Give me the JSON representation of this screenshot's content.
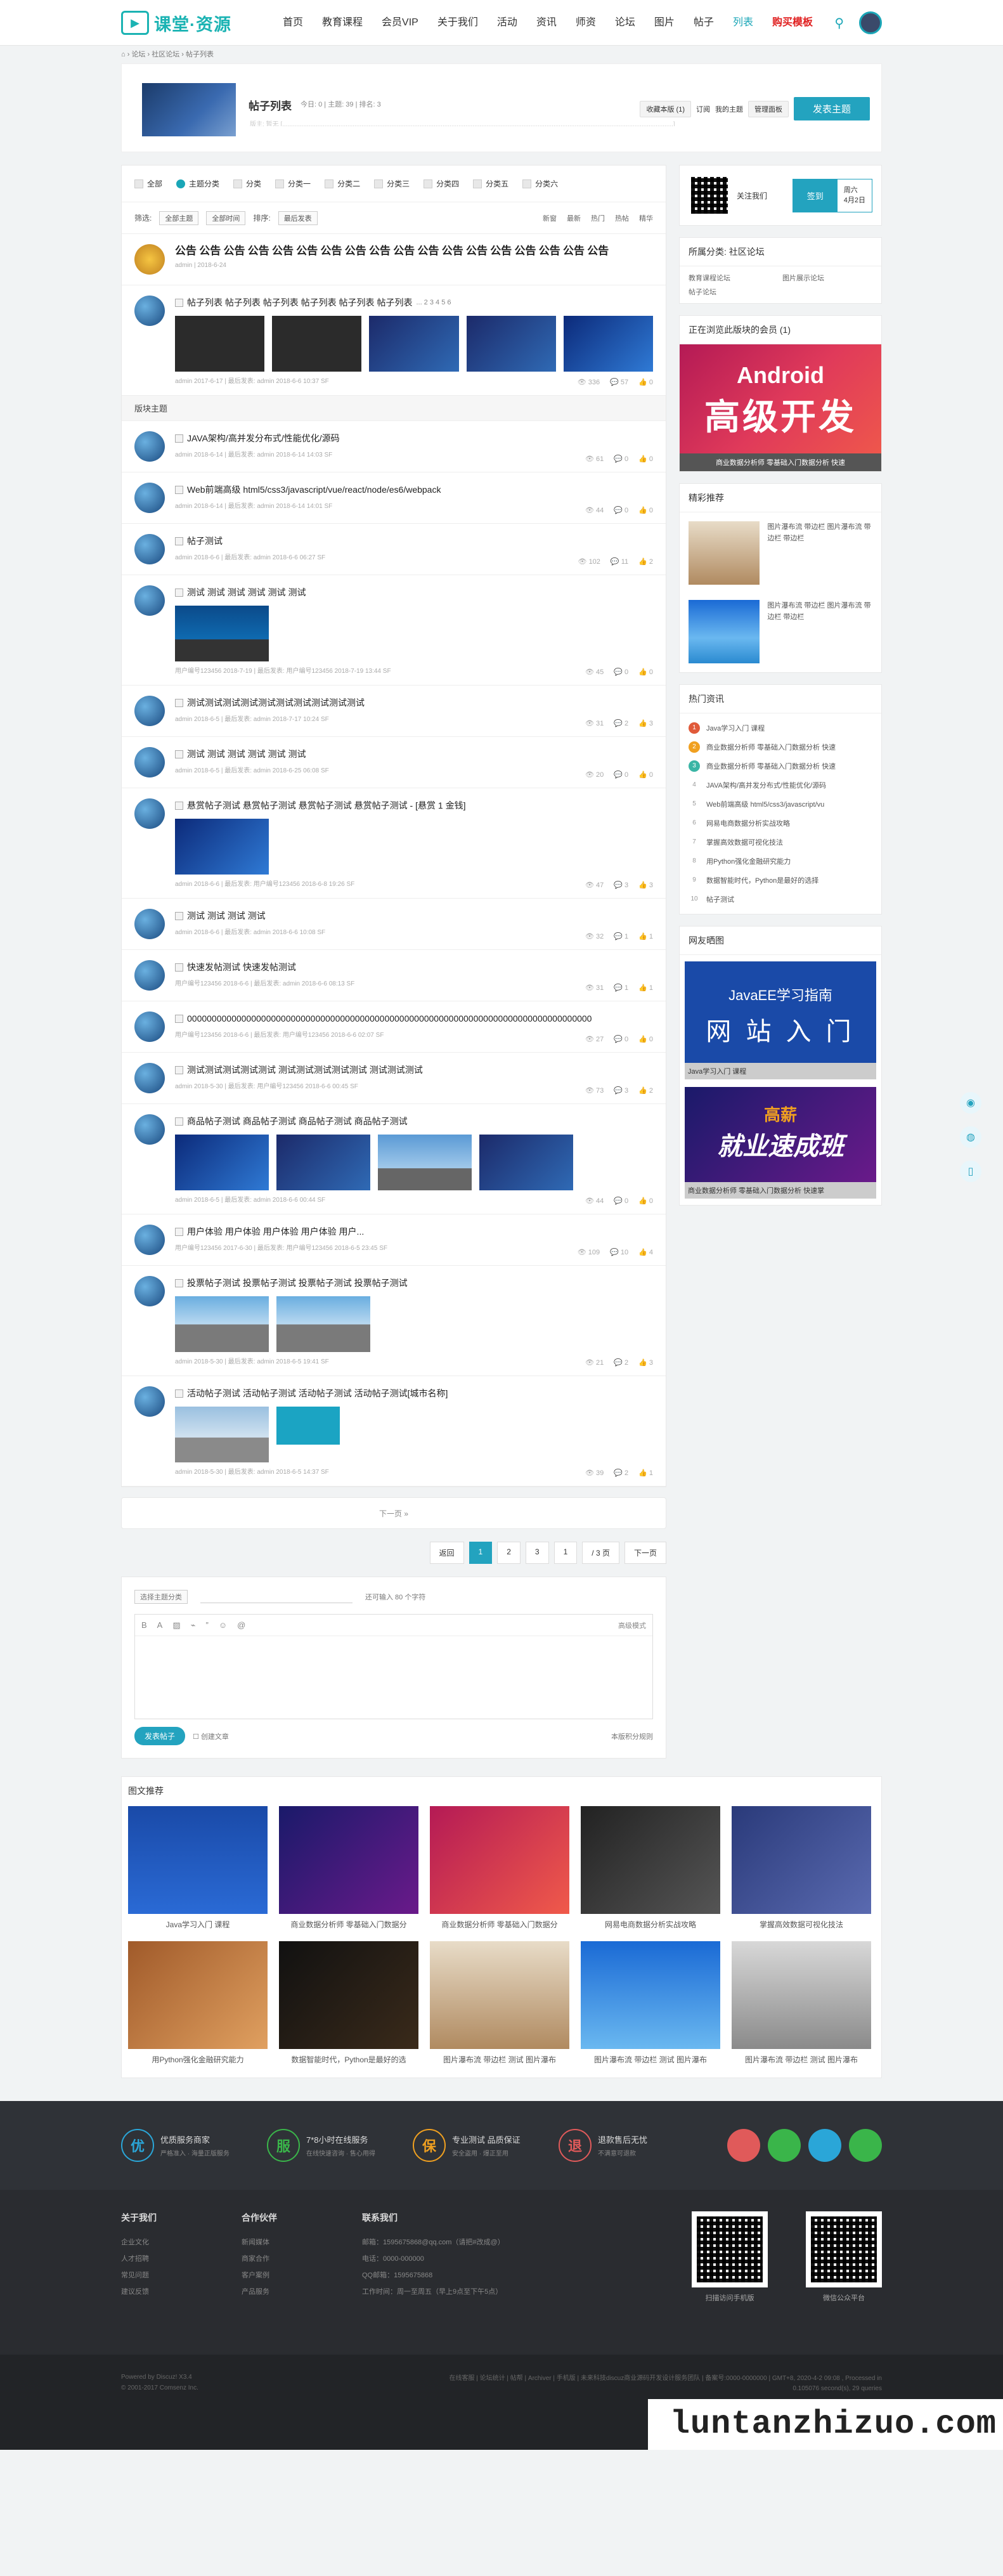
{
  "header": {
    "logo_text": "课堂·资源",
    "nav": [
      "首页",
      "教育课程",
      "会员VIP",
      "关于我们",
      "活动",
      "资讯",
      "师资",
      "论坛",
      "图片",
      "帖子",
      "列表",
      "购买模板"
    ],
    "active_nav": "列表"
  },
  "breadcrumb": [
    "论坛",
    "社区论坛",
    "帖子列表"
  ],
  "banner": {
    "title": "帖子列表",
    "stats": "今日: 0 | 主题: 39 | 排名: 3",
    "moderator": "版主: 暂无 [..............................................................................................................................................................................................................................]",
    "fav": "收藏本版 (1)",
    "sub": "订阅",
    "rss": "我的主题",
    "board": "管理面板",
    "post_btn": "发表主题"
  },
  "tabs": [
    "全部",
    "主题分类",
    "分类",
    "分类一",
    "分类二",
    "分类三",
    "分类四",
    "分类五",
    "分类六"
  ],
  "filters": {
    "label_filter": "筛选:",
    "f1": "全部主题",
    "f2": "全部时间",
    "label_sort": "排序:",
    "f3": "最后发表",
    "sorts": [
      "新窗",
      "最新",
      "热门",
      "热帖",
      "精华"
    ]
  },
  "sticky": {
    "title": "公告 公告 公告 公告 公告 公告 公告 公告 公告 公告 公告 公告 公告 公告 公告 公告 公告 公告",
    "meta": "admin | 2018-6-24"
  },
  "top_post": {
    "title": "帖子列表 帖子列表 帖子列表 帖子列表 帖子列表 帖子列表",
    "pages": "... 2 3 4 5 6",
    "meta": "admin 2017-6-17 | 最后发表: admin 2018-6-6 10:37 SF",
    "stats": [
      "336",
      "57",
      "0"
    ]
  },
  "section_label": "版块主题",
  "posts": [
    {
      "title": "JAVA架构/高并发分布式/性能优化/源码",
      "meta": "admin 2018-6-14 | 最后发表: admin 2018-6-14 14:03 SF",
      "stats": [
        "61",
        "0",
        "0"
      ],
      "imgs": []
    },
    {
      "title": "Web前端高级 html5/css3/javascript/vue/react/node/es6/webpack",
      "meta": "admin 2018-6-14 | 最后发表: admin 2018-6-14 14:01 SF",
      "stats": [
        "44",
        "0",
        "0"
      ],
      "imgs": []
    },
    {
      "title": "帖子测试",
      "meta": "admin 2018-6-6 | 最后发表: admin 2018-6-6 06:27 SF",
      "stats": [
        "102",
        "11",
        "2"
      ],
      "imgs": []
    },
    {
      "title": "测试 测试 测试 测试 测试 测试",
      "meta": "用户编号123456 2018-7-19 | 最后发表: 用户编号123456 2018-7-19 13:44 SF",
      "stats": [
        "45",
        "0",
        "0"
      ],
      "imgs": [
        "car"
      ]
    },
    {
      "title": "测试测试测试测试测试测试测试测试测试测试",
      "meta": "admin 2018-6-5 | 最后发表: admin 2018-7-17 10:24 SF",
      "stats": [
        "31",
        "2",
        "3"
      ],
      "imgs": []
    },
    {
      "title": "测试 测试 测试 测试 测试 测试",
      "meta": "admin 2018-6-5 | 最后发表: admin 2018-6-25 06:08 SF",
      "stats": [
        "20",
        "0",
        "0"
      ],
      "imgs": []
    },
    {
      "title": "悬赏帖子测试 悬赏帖子测试 悬赏帖子测试 悬赏帖子测试 - [悬赏 1 金钱]",
      "meta": "admin 2018-6-6 | 最后发表: 用户编号123456 2018-6-8 19:26 SF",
      "stats": [
        "47",
        "3",
        "3"
      ],
      "imgs": [
        "blue"
      ]
    },
    {
      "title": "测试 测试 测试 测试",
      "meta": "admin 2018-6-6 | 最后发表: admin 2018-6-6 10:08 SF",
      "stats": [
        "32",
        "1",
        "1"
      ],
      "imgs": []
    },
    {
      "title": "快速发帖测试 快速发帖测试",
      "meta": "用户编号123456 2018-6-6 | 最后发表: admin 2018-6-6 08:13 SF",
      "stats": [
        "31",
        "1",
        "1"
      ],
      "imgs": []
    },
    {
      "title": "0000000000000000000000000000000000000000000000000000000000000000000000000000000000",
      "meta": "用户编号123456 2018-6-6 | 最后发表: 用户编号123456 2018-6-6 02:07 SF",
      "stats": [
        "27",
        "0",
        "0"
      ],
      "imgs": []
    },
    {
      "title": "测试测试测试测试测试 测试测试测试测试测试 测试测试测试",
      "meta": "admin 2018-5-30 | 最后发表: 用户编号123456 2018-6-6 00:45 SF",
      "stats": [
        "73",
        "3",
        "2"
      ],
      "imgs": []
    },
    {
      "title": "商品帖子测试 商品帖子测试 商品帖子测试 商品帖子测试",
      "meta": "admin 2018-6-5 | 最后发表: admin 2018-6-6 00:44 SF",
      "stats": [
        "44",
        "0",
        "0"
      ],
      "imgs": [
        "blue",
        "tech",
        "city",
        "tech"
      ]
    },
    {
      "title": "用户体验 用户体验 用户体验 用户体验 用户...",
      "meta": "用户编号123456 2017-6-30 | 最后发表: 用户编号123456 2018-6-5 23:45 SF",
      "stats": [
        "109",
        "10",
        "4"
      ],
      "imgs": []
    },
    {
      "title": "投票帖子测试 投票帖子测试 投票帖子测试 投票帖子测试",
      "meta": "admin 2018-5-30 | 最后发表: admin 2018-6-5 19:41 SF",
      "stats": [
        "21",
        "2",
        "3"
      ],
      "imgs": [
        "build",
        "build"
      ]
    },
    {
      "title": "活动帖子测试 活动帖子测试 活动帖子测试 活动帖子测试[城市名称]",
      "meta": "admin 2018-5-30 | 最后发表: admin 2018-6-5 14:37 SF",
      "stats": [
        "39",
        "2",
        "1"
      ],
      "imgs": [
        "mcity",
        "teal"
      ]
    }
  ],
  "more": "下一页 »",
  "pager": [
    "返回",
    "1",
    "2",
    "3",
    "1",
    "/ 3 页",
    "下一页"
  ],
  "editor": {
    "select": "选择主题分类",
    "hint": "还可输入 80 个字符",
    "tools": [
      "B",
      "A",
      "▨",
      "⌁",
      "”",
      "☺",
      "@"
    ],
    "adv": "高级模式",
    "rules": "本版积分规则",
    "submit": "发表帖子",
    "check": "创建文章"
  },
  "sidebar": {
    "signin_label": "关注我们",
    "signin_btn": "签到",
    "signin_date": "周六\n4月2日",
    "category": "所属分类: 社区论坛",
    "cat_links": [
      "教育课程论坛",
      "图片展示论坛",
      "帖子论坛"
    ],
    "online": "正在浏览此版块的会员 (1)",
    "ad_title": "Android",
    "ad_big": "高级开发",
    "ad_sub": "商业数据分析师 零基础入门数据分析 快速",
    "featured_head": "精彩推荐",
    "featured": [
      "图片瀑布流 带边栏 图片瀑布流 带边栏 带边栏",
      "图片瀑布流 带边栏 图片瀑布流 带边栏 带边栏"
    ],
    "hot_head": "热门资讯",
    "hot": [
      "Java学习入门 课程",
      "商业数据分析师 零基础入门数据分析 快速",
      "商业数据分析师 零基础入门数据分析 快速",
      "JAVA架构/高并发分布式/性能优化/源码",
      "Web前端高级 html5/css3/javascript/vu",
      "网易电商数据分析实战攻略",
      "掌握高效数据可视化技法",
      "用Python强化金融研究能力",
      "数据智能时代，Python是最好的选择",
      "帖子测试"
    ],
    "gallery_head": "网友晒图",
    "gallery": [
      {
        "t1": "JavaEE学习指南",
        "t2": "网 站 入 门",
        "cap": "Java学习入门 课程"
      },
      {
        "t1": "高薪",
        "t2": "就业速成班",
        "cap": "商业数据分析师 零基础入门数据分析 快速掌"
      }
    ]
  },
  "gallery": {
    "head": "图文推荐",
    "items": [
      "Java学习入门 课程",
      "商业数据分析师 零基础入门数据分",
      "商业数据分析师 零基础入门数据分",
      "网易电商数据分析实战攻略",
      "掌握高效数据可视化技法",
      "用Python强化金融研究能力",
      "数据智能时代，Python是最好的选",
      "图片瀑布流 带边栏 测试 图片瀑布",
      "图片瀑布流 带边栏 测试 图片瀑布",
      "图片瀑布流 带边栏 测试 图片瀑布"
    ]
  },
  "services": [
    {
      "c": "优",
      "t": "优质服务商家",
      "s": "严格准入 · 海量正版服务"
    },
    {
      "c": "服",
      "t": "7*8小时在线服务",
      "s": "在线快速咨询 · 售心用得"
    },
    {
      "c": "保",
      "t": "专业测试 品质保证",
      "s": "安全盗用 · 爆正至用"
    },
    {
      "c": "退",
      "t": "退款售后无忧",
      "s": "不满意可退款"
    }
  ],
  "footer_cols": [
    {
      "h": "关于我们",
      "items": [
        "企业文化",
        "人才招聘",
        "常见问题",
        "建议反馈"
      ]
    },
    {
      "h": "合作伙伴",
      "items": [
        "新闻媒体",
        "商家合作",
        "客户案例",
        "产品服务"
      ]
    },
    {
      "h": "联系我们",
      "items": [
        "邮箱：1595675868@qq.com（请把#改成@）",
        "电话：0000-000000",
        "QQ邮箱：1595675868",
        "工作时间：周一至周五（早上9点至下午5点）"
      ]
    }
  ],
  "qr": [
    "扫描访问手机版",
    "微信公众平台"
  ],
  "copyright": [
    "Powered by Discuz! X3.4",
    "© 2001-2017 Comsenz Inc."
  ],
  "footer_links": "在线客服 | 论坛统计 | 帖帮 | Archiver | 手机版 | 未来科技discuz商业源码开发设计服务团队 | 备案号:0000-0000000 | GMT+8, 2020-4-2 09:08 , Processed in 0.105076 second(s), 29 queries",
  "watermark": "luntanzhizuo.com"
}
